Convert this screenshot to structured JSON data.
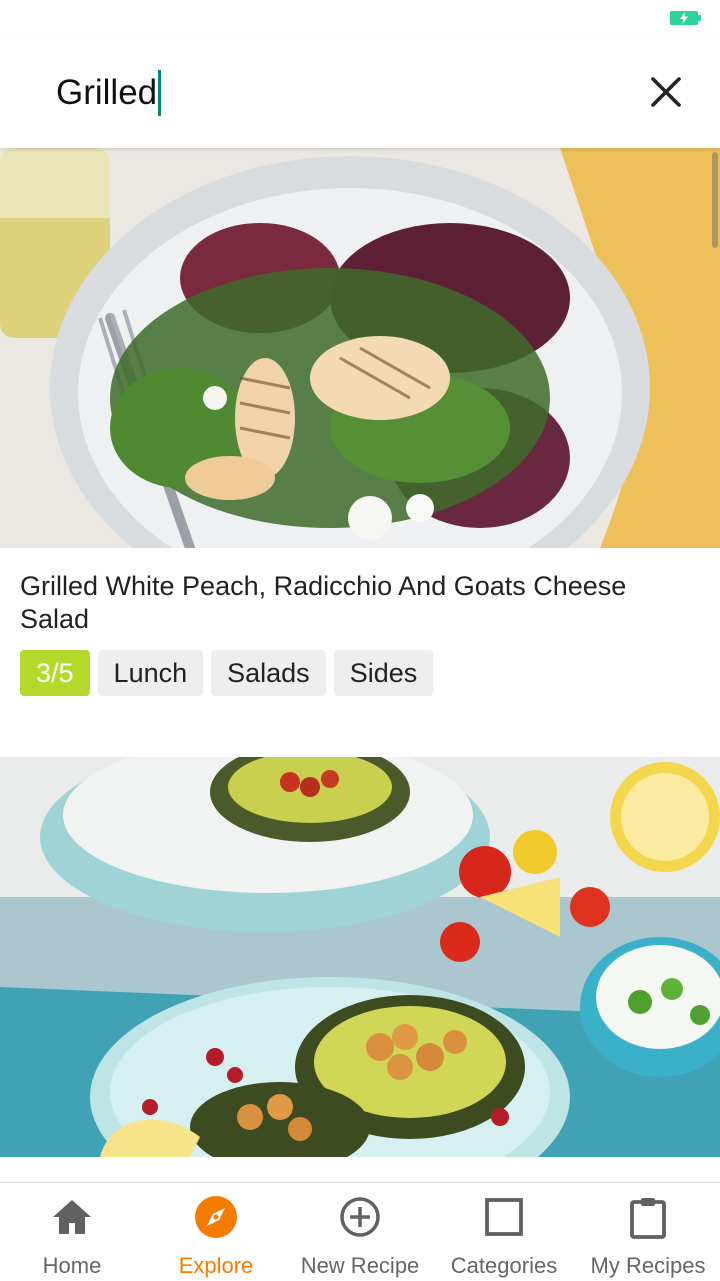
{
  "search": {
    "query": "Grilled"
  },
  "colors": {
    "accent": "#f57c00",
    "rating_tag": "#b5d92b",
    "caret": "#00897b",
    "battery": "#2bd49a"
  },
  "recipes": [
    {
      "title": "Grilled White Peach, Radicchio And Goats Cheese Salad",
      "rating": "3/5",
      "tags": [
        "Lunch",
        "Salads",
        "Sides"
      ]
    },
    {
      "title": "",
      "rating": "",
      "tags": []
    }
  ],
  "nav": {
    "items": [
      {
        "label": "Home",
        "icon": "home-icon",
        "active": false
      },
      {
        "label": "Explore",
        "icon": "compass-icon",
        "active": true
      },
      {
        "label": "New Recipe",
        "icon": "add-circle-icon",
        "active": false
      },
      {
        "label": "Categories",
        "icon": "square-icon",
        "active": false
      },
      {
        "label": "My Recipes",
        "icon": "clipboard-icon",
        "active": false
      }
    ]
  }
}
